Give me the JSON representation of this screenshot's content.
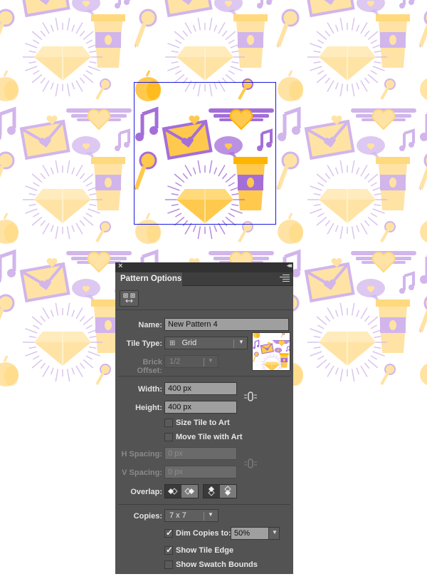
{
  "canvas": {
    "colors": {
      "yellow": "#ffc94d",
      "yellow_light": "#ffe49a",
      "orange": "#ffb400",
      "purple": "#a46ed8",
      "purple_light": "#d4b9ef",
      "tile_edge": "#1a1adb"
    }
  },
  "panel": {
    "title": "Pattern Options",
    "close_glyph": "×",
    "collapse_glyph": "◂◂",
    "name_label": "Name:",
    "name_value": "New Pattern 4",
    "tile_type_label": "Tile Type:",
    "tile_type_value": "Grid",
    "brick_offset_label": "Brick Offset:",
    "brick_offset_value": "1/2",
    "width_label": "Width:",
    "width_value": "400 px",
    "height_label": "Height:",
    "height_value": "400 px",
    "size_tile_to_art_label": "Size Tile to Art",
    "size_tile_to_art_checked": false,
    "move_tile_with_art_label": "Move Tile with Art",
    "move_tile_with_art_checked": false,
    "h_spacing_label": "H Spacing:",
    "h_spacing_value": "0 px",
    "v_spacing_label": "V Spacing:",
    "v_spacing_value": "0 px",
    "overlap_label": "Overlap:",
    "copies_label": "Copies:",
    "copies_value": "7 x 7",
    "dim_copies_label": "Dim Copies to:",
    "dim_copies_checked": true,
    "dim_copies_value": "50%",
    "show_tile_edge_label": "Show Tile Edge",
    "show_tile_edge_checked": true,
    "show_swatch_bounds_label": "Show Swatch Bounds",
    "show_swatch_bounds_checked": false,
    "check_glyph": "✓",
    "link_glyph": "⛓"
  }
}
